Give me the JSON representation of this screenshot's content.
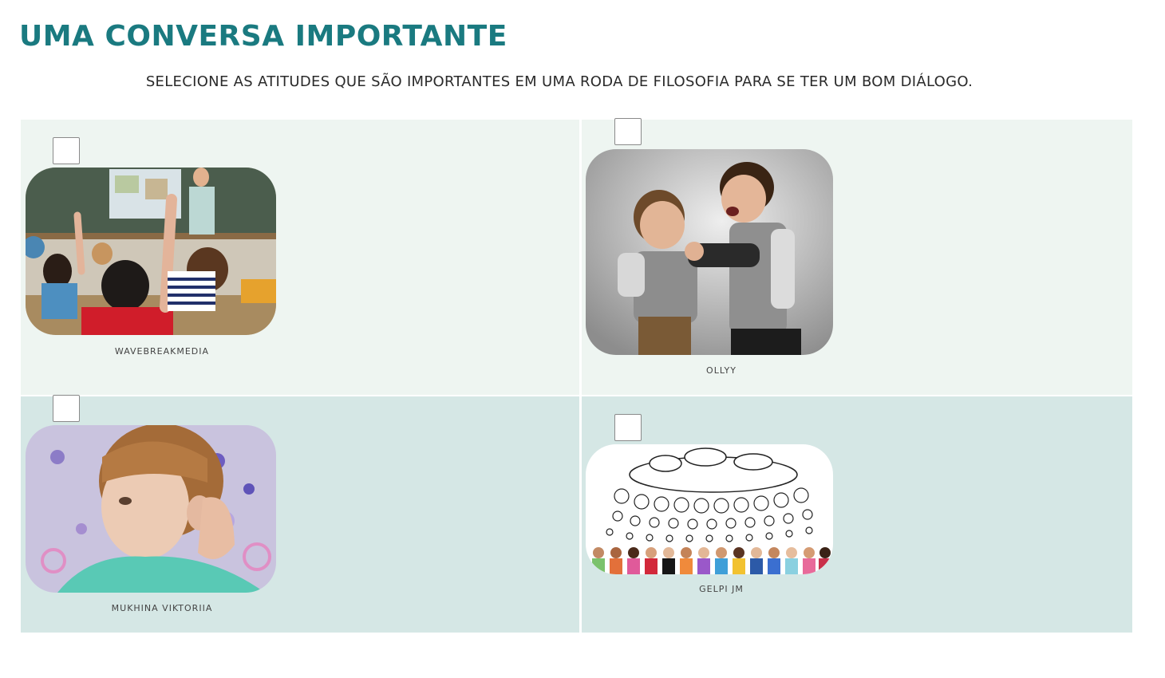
{
  "header": {
    "title": "UMA CONVERSA IMPORTANTE",
    "instructions": "SELECIONE AS ATITUDES QUE SÃO IMPORTANTES EM UMA RODA DE FILOSOFIA PARA SE TER UM BOM DIÁLOGO."
  },
  "options": [
    {
      "credit": "WAVEBREAKMEDIA",
      "checked": false,
      "image": "classroom-hands-raised"
    },
    {
      "credit": "OLLYY",
      "checked": false,
      "image": "children-fighting"
    },
    {
      "credit": "MUKHINA VIKTORIIA",
      "checked": false,
      "image": "girl-listening"
    },
    {
      "credit": "GELPI JM",
      "checked": false,
      "image": "children-thought-bubbles"
    }
  ],
  "colors": {
    "title": "#1a7a80",
    "cell_light": "#eef5f1",
    "cell_teal": "#d5e7e5"
  }
}
